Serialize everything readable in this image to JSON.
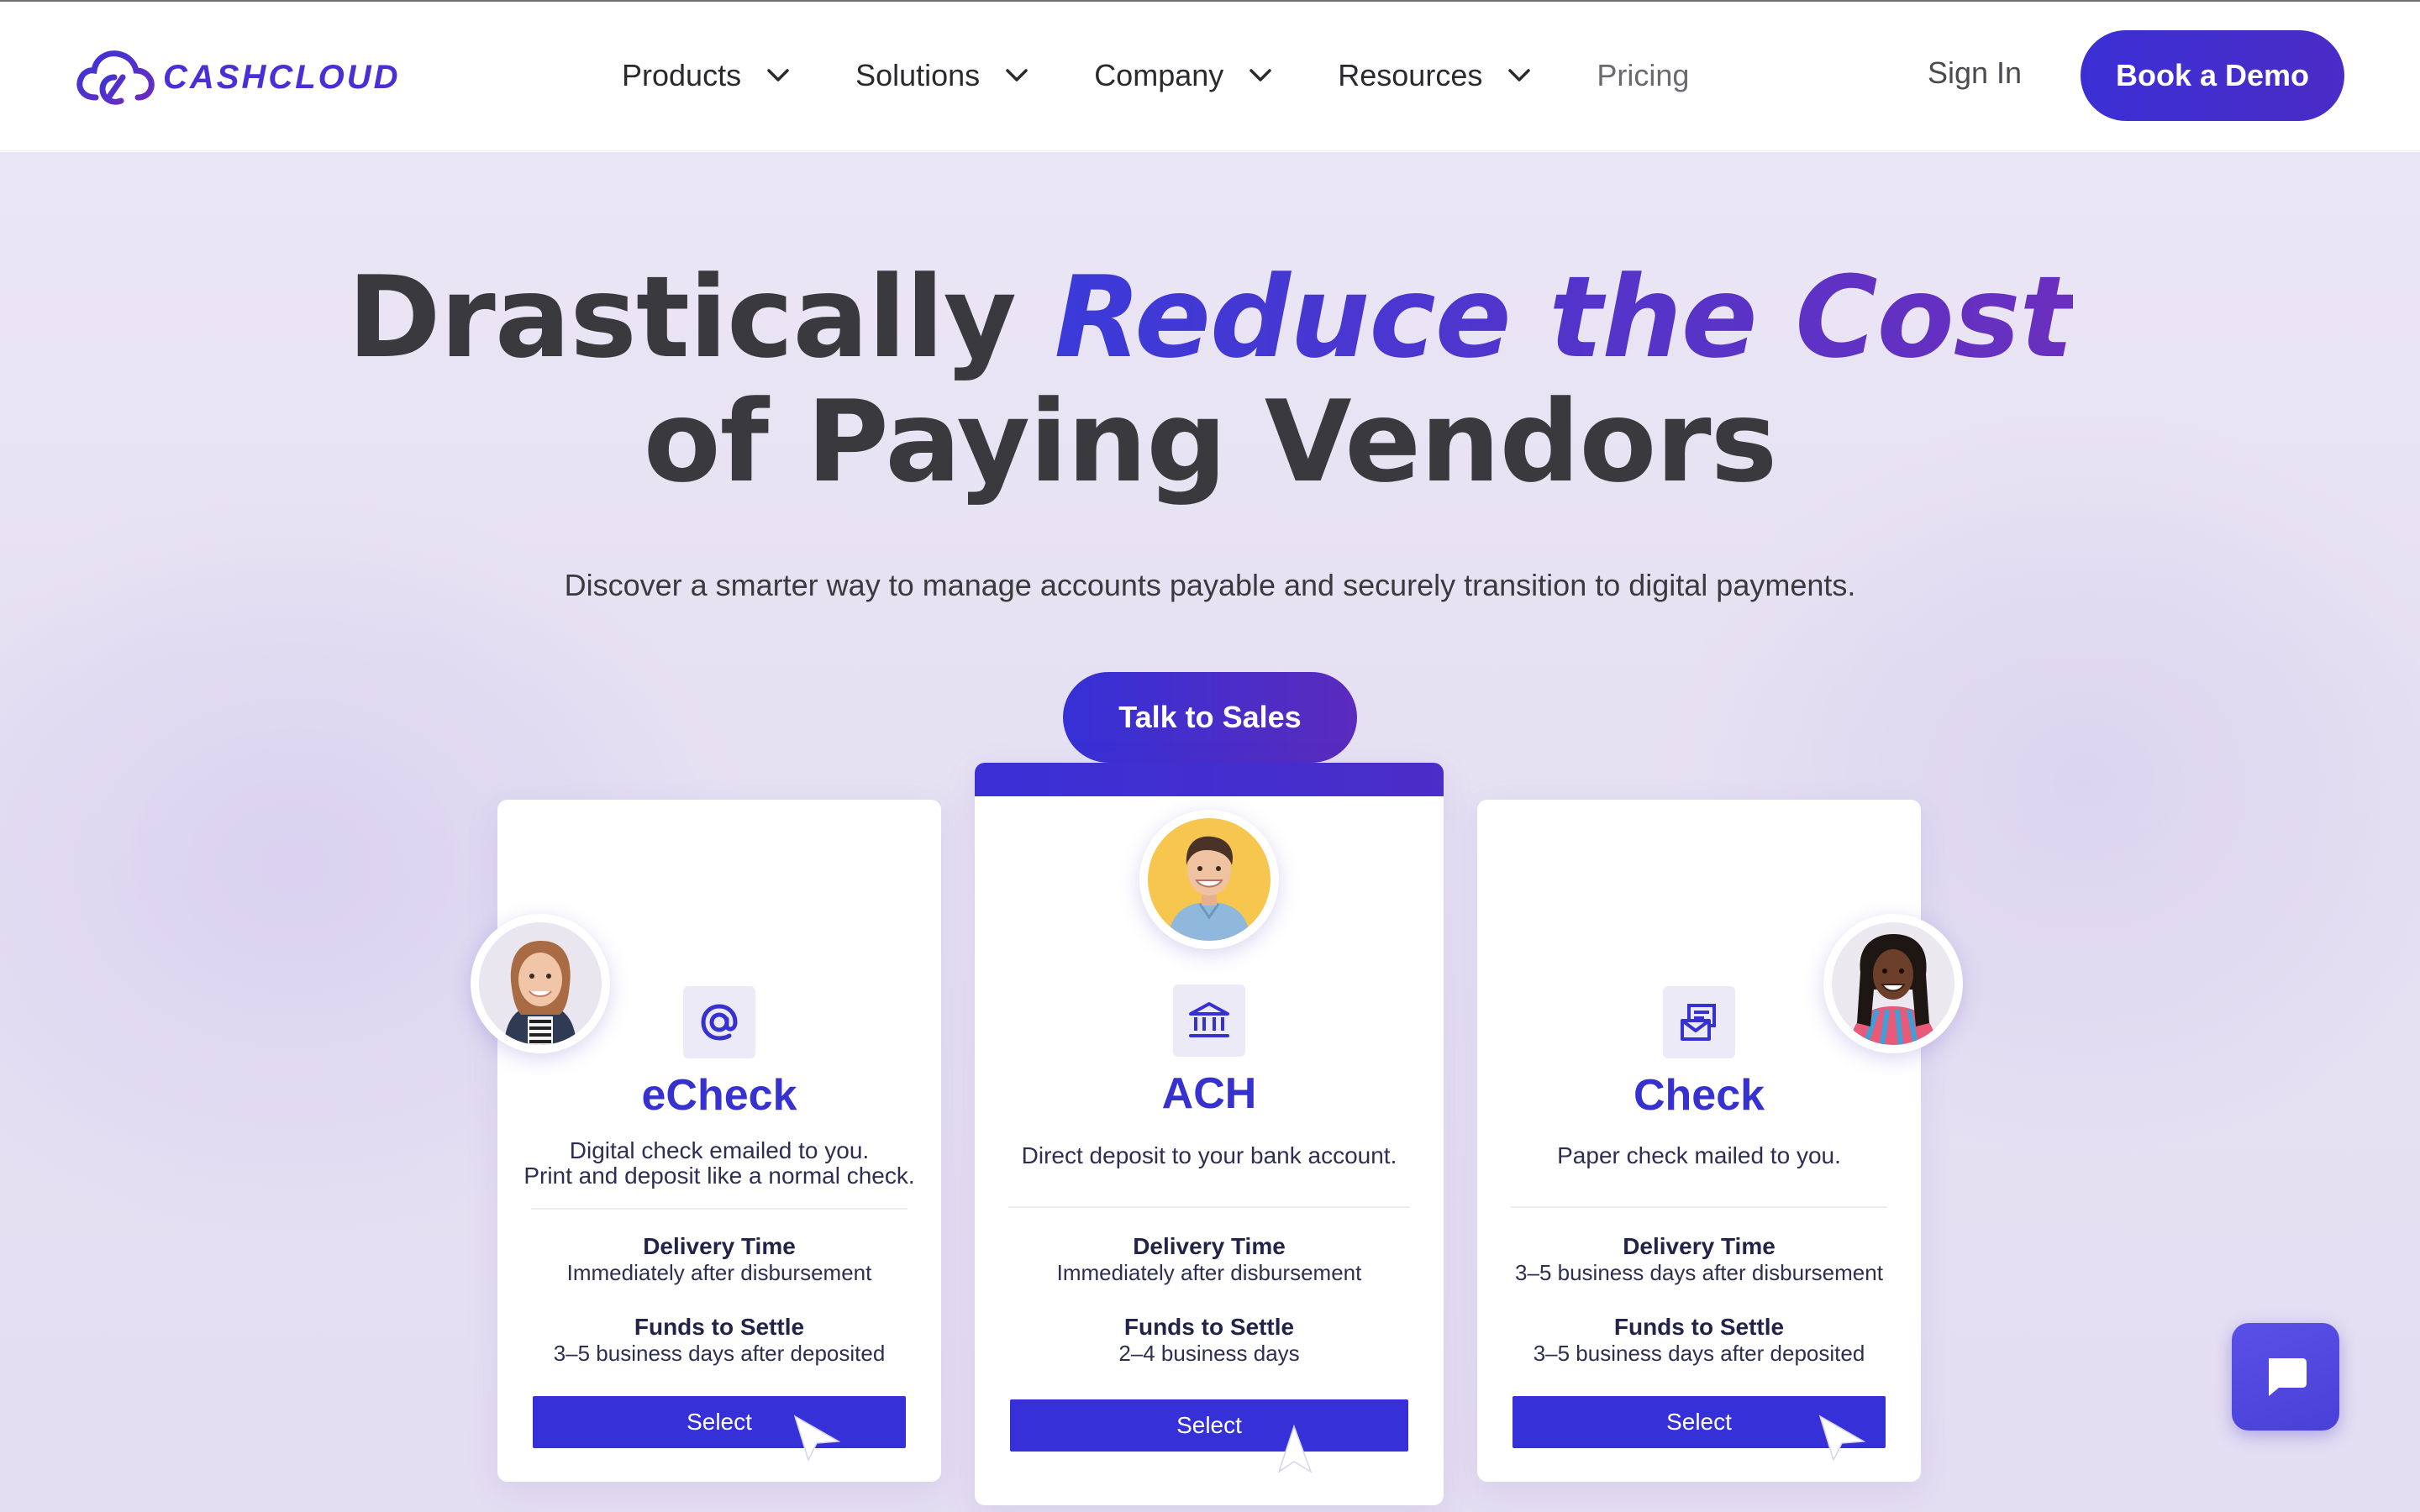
{
  "brand": {
    "name": "CASHCLOUD"
  },
  "nav": {
    "items": [
      {
        "label": "Products"
      },
      {
        "label": "Solutions"
      },
      {
        "label": "Company"
      },
      {
        "label": "Resources"
      }
    ],
    "pricing": "Pricing",
    "sign_in": "Sign In",
    "book_demo": "Book a Demo"
  },
  "hero": {
    "headline_prefix": "Drastically ",
    "headline_accent": "Reduce the Cost",
    "headline_line2": "of Paying Vendors",
    "subtext": "Discover a smarter way to manage accounts payable and securely transition to digital payments.",
    "cta": "Talk to Sales"
  },
  "cards": [
    {
      "icon": "at-sign-icon",
      "title": "eCheck",
      "desc_line1": "Digital check emailed to you.",
      "desc_line2": "Print and deposit like a normal check.",
      "delivery_label": "Delivery Time",
      "delivery_value": "Immediately after disbursement",
      "settle_label": "Funds to Settle",
      "settle_value": "3–5 business days after deposited",
      "select": "Select"
    },
    {
      "icon": "bank-icon",
      "title": "ACH",
      "desc_line1": "Direct deposit to your bank account.",
      "desc_line2": "",
      "delivery_label": "Delivery Time",
      "delivery_value": "Immediately after disbursement",
      "settle_label": "Funds to Settle",
      "settle_value": "2–4 business days",
      "select": "Select"
    },
    {
      "icon": "mail-check-icon",
      "title": "Check",
      "desc_line1": "Paper check mailed to you.",
      "desc_line2": "",
      "delivery_label": "Delivery Time",
      "delivery_value": "3–5 business days after disbursement",
      "settle_label": "Funds to Settle",
      "settle_value": "3–5 business days after deposited",
      "select": "Select"
    }
  ],
  "colors": {
    "brand": "#3b2fd4",
    "accent_gradient_end": "#6a2fbe",
    "hero_bg": "#e8e3f4",
    "text": "#3a3a3e"
  },
  "chat": {
    "icon": "chat-bubble-icon"
  }
}
